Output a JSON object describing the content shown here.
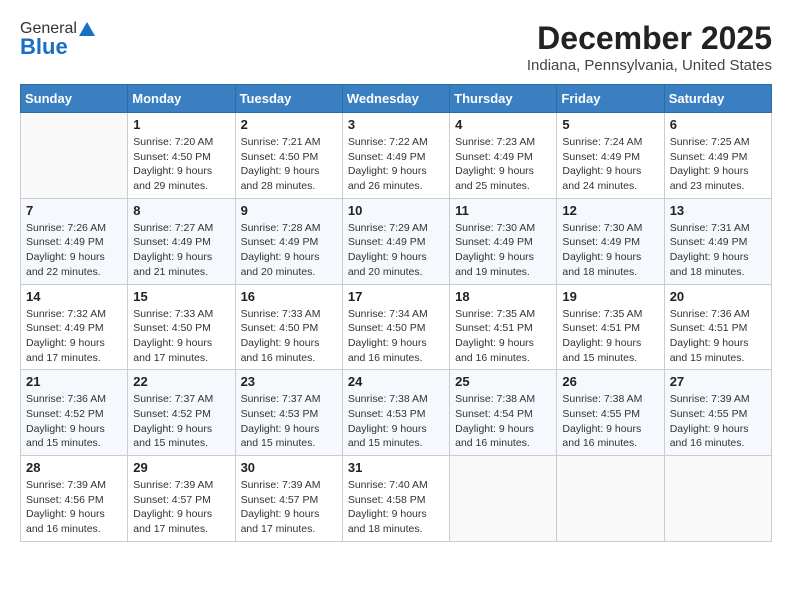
{
  "logo": {
    "general": "General",
    "blue": "Blue"
  },
  "title": "December 2025",
  "subtitle": "Indiana, Pennsylvania, United States",
  "days_of_week": [
    "Sunday",
    "Monday",
    "Tuesday",
    "Wednesday",
    "Thursday",
    "Friday",
    "Saturday"
  ],
  "weeks": [
    [
      {
        "day": "",
        "info": ""
      },
      {
        "day": "1",
        "info": "Sunrise: 7:20 AM\nSunset: 4:50 PM\nDaylight: 9 hours\nand 29 minutes."
      },
      {
        "day": "2",
        "info": "Sunrise: 7:21 AM\nSunset: 4:50 PM\nDaylight: 9 hours\nand 28 minutes."
      },
      {
        "day": "3",
        "info": "Sunrise: 7:22 AM\nSunset: 4:49 PM\nDaylight: 9 hours\nand 26 minutes."
      },
      {
        "day": "4",
        "info": "Sunrise: 7:23 AM\nSunset: 4:49 PM\nDaylight: 9 hours\nand 25 minutes."
      },
      {
        "day": "5",
        "info": "Sunrise: 7:24 AM\nSunset: 4:49 PM\nDaylight: 9 hours\nand 24 minutes."
      },
      {
        "day": "6",
        "info": "Sunrise: 7:25 AM\nSunset: 4:49 PM\nDaylight: 9 hours\nand 23 minutes."
      }
    ],
    [
      {
        "day": "7",
        "info": "Sunrise: 7:26 AM\nSunset: 4:49 PM\nDaylight: 9 hours\nand 22 minutes."
      },
      {
        "day": "8",
        "info": "Sunrise: 7:27 AM\nSunset: 4:49 PM\nDaylight: 9 hours\nand 21 minutes."
      },
      {
        "day": "9",
        "info": "Sunrise: 7:28 AM\nSunset: 4:49 PM\nDaylight: 9 hours\nand 20 minutes."
      },
      {
        "day": "10",
        "info": "Sunrise: 7:29 AM\nSunset: 4:49 PM\nDaylight: 9 hours\nand 20 minutes."
      },
      {
        "day": "11",
        "info": "Sunrise: 7:30 AM\nSunset: 4:49 PM\nDaylight: 9 hours\nand 19 minutes."
      },
      {
        "day": "12",
        "info": "Sunrise: 7:30 AM\nSunset: 4:49 PM\nDaylight: 9 hours\nand 18 minutes."
      },
      {
        "day": "13",
        "info": "Sunrise: 7:31 AM\nSunset: 4:49 PM\nDaylight: 9 hours\nand 18 minutes."
      }
    ],
    [
      {
        "day": "14",
        "info": "Sunrise: 7:32 AM\nSunset: 4:49 PM\nDaylight: 9 hours\nand 17 minutes."
      },
      {
        "day": "15",
        "info": "Sunrise: 7:33 AM\nSunset: 4:50 PM\nDaylight: 9 hours\nand 17 minutes."
      },
      {
        "day": "16",
        "info": "Sunrise: 7:33 AM\nSunset: 4:50 PM\nDaylight: 9 hours\nand 16 minutes."
      },
      {
        "day": "17",
        "info": "Sunrise: 7:34 AM\nSunset: 4:50 PM\nDaylight: 9 hours\nand 16 minutes."
      },
      {
        "day": "18",
        "info": "Sunrise: 7:35 AM\nSunset: 4:51 PM\nDaylight: 9 hours\nand 16 minutes."
      },
      {
        "day": "19",
        "info": "Sunrise: 7:35 AM\nSunset: 4:51 PM\nDaylight: 9 hours\nand 15 minutes."
      },
      {
        "day": "20",
        "info": "Sunrise: 7:36 AM\nSunset: 4:51 PM\nDaylight: 9 hours\nand 15 minutes."
      }
    ],
    [
      {
        "day": "21",
        "info": "Sunrise: 7:36 AM\nSunset: 4:52 PM\nDaylight: 9 hours\nand 15 minutes."
      },
      {
        "day": "22",
        "info": "Sunrise: 7:37 AM\nSunset: 4:52 PM\nDaylight: 9 hours\nand 15 minutes."
      },
      {
        "day": "23",
        "info": "Sunrise: 7:37 AM\nSunset: 4:53 PM\nDaylight: 9 hours\nand 15 minutes."
      },
      {
        "day": "24",
        "info": "Sunrise: 7:38 AM\nSunset: 4:53 PM\nDaylight: 9 hours\nand 15 minutes."
      },
      {
        "day": "25",
        "info": "Sunrise: 7:38 AM\nSunset: 4:54 PM\nDaylight: 9 hours\nand 16 minutes."
      },
      {
        "day": "26",
        "info": "Sunrise: 7:38 AM\nSunset: 4:55 PM\nDaylight: 9 hours\nand 16 minutes."
      },
      {
        "day": "27",
        "info": "Sunrise: 7:39 AM\nSunset: 4:55 PM\nDaylight: 9 hours\nand 16 minutes."
      }
    ],
    [
      {
        "day": "28",
        "info": "Sunrise: 7:39 AM\nSunset: 4:56 PM\nDaylight: 9 hours\nand 16 minutes."
      },
      {
        "day": "29",
        "info": "Sunrise: 7:39 AM\nSunset: 4:57 PM\nDaylight: 9 hours\nand 17 minutes."
      },
      {
        "day": "30",
        "info": "Sunrise: 7:39 AM\nSunset: 4:57 PM\nDaylight: 9 hours\nand 17 minutes."
      },
      {
        "day": "31",
        "info": "Sunrise: 7:40 AM\nSunset: 4:58 PM\nDaylight: 9 hours\nand 18 minutes."
      },
      {
        "day": "",
        "info": ""
      },
      {
        "day": "",
        "info": ""
      },
      {
        "day": "",
        "info": ""
      }
    ]
  ]
}
